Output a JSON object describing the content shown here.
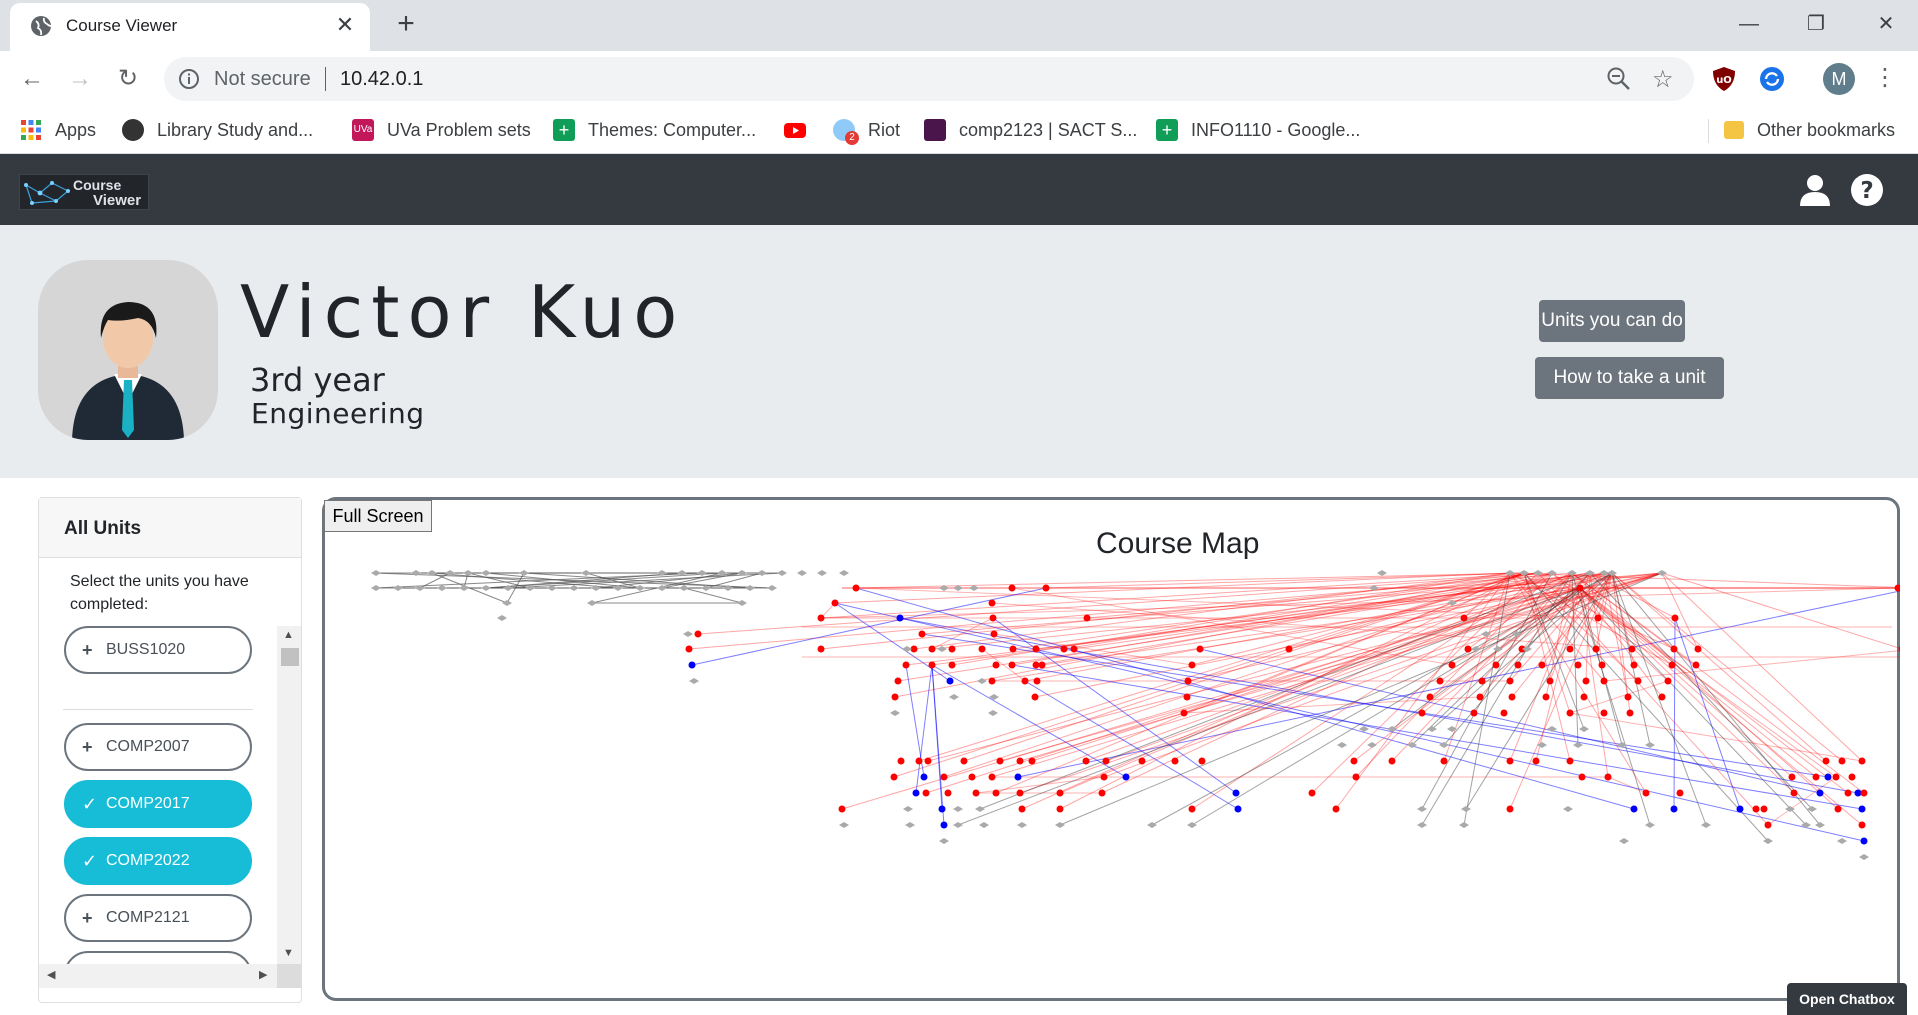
{
  "browser": {
    "tab_title": "Course Viewer",
    "close_glyph": "✕",
    "newtab_glyph": "+",
    "url_security": "Not secure",
    "url": "10.42.0.1",
    "profile_initial": "M",
    "window_controls": [
      "—",
      "❐",
      "✕"
    ],
    "bookmarks": [
      {
        "label": "Apps",
        "icon": "apps-grid-icon",
        "color": "#4285f4"
      },
      {
        "label": "Library Study and...",
        "icon": "library-icon",
        "color": "#333333"
      },
      {
        "label": "UVa Problem sets",
        "icon": "uva-icon",
        "color": "#c2185b"
      },
      {
        "label": "Themes: Computer...",
        "icon": "sheets-icon",
        "color": "#0f9d58"
      },
      {
        "label": "",
        "icon": "youtube-icon",
        "color": "#ff0000"
      },
      {
        "label": "Riot",
        "icon": "riot-icon",
        "color": "#1e88e5"
      },
      {
        "label": "comp2123 | SACT S...",
        "icon": "slack-icon",
        "color": "#4a154b"
      },
      {
        "label": "INFO1110 - Google...",
        "icon": "sheets-icon",
        "color": "#0f9d58"
      },
      {
        "label": "Other bookmarks",
        "icon": "folder-icon",
        "color": "#f4c542"
      }
    ]
  },
  "navbar": {
    "logo_line1": "Course",
    "logo_line2": "Viewer"
  },
  "profile": {
    "name": "Victor Kuo",
    "year": "3rd year",
    "degree": "Engineering",
    "buttons": {
      "units": "Units you can do",
      "how": "How to take a unit"
    }
  },
  "sidebar": {
    "title": "All Units",
    "instructions": "Select the units you have completed:",
    "units": [
      {
        "code": "BUSS1020",
        "completed": false
      },
      {
        "code": "COMP2007",
        "completed": false
      },
      {
        "code": "COMP2017",
        "completed": true
      },
      {
        "code": "COMP2022",
        "completed": true
      },
      {
        "code": "COMP2121",
        "completed": false
      }
    ],
    "plus_glyph": "+",
    "check_glyph": "✓"
  },
  "map": {
    "fullscreen_label": "Full Screen",
    "title": "Course Map",
    "colors": {
      "completed": "#ff0000",
      "available": "#0000ff",
      "locked": "#aaaaaa"
    }
  },
  "chatbox": {
    "label": "Open Chatbox"
  }
}
